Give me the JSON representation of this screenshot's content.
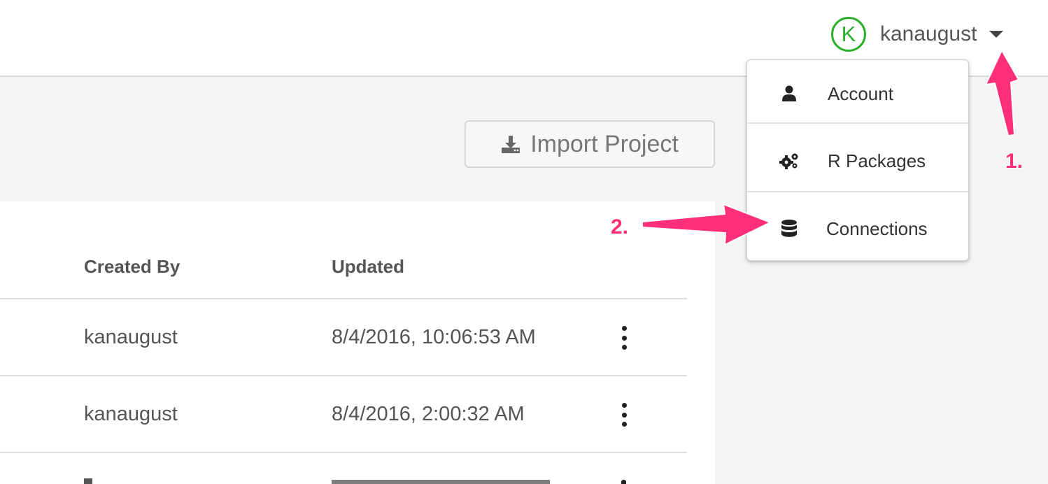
{
  "header": {
    "avatar_letter": "K",
    "username": "kanaugust",
    "accent_color": "#2bb02b"
  },
  "toolbar": {
    "import_label": "Import Project",
    "import_icon": "download-tray-icon"
  },
  "table": {
    "columns": [
      "Created By",
      "Updated"
    ],
    "rows": [
      {
        "created_by": "kanaugust",
        "updated": "8/4/2016, 10:06:53 AM"
      },
      {
        "created_by": "kanaugust",
        "updated": "8/4/2016, 2:00:32 AM"
      }
    ]
  },
  "menu": {
    "items": [
      {
        "label": "Account",
        "icon": "user-icon"
      },
      {
        "label": "R Packages",
        "icon": "gears-icon"
      },
      {
        "label": "Connections",
        "icon": "database-icon"
      }
    ]
  },
  "annotations": {
    "step1": "1.",
    "step2": "2.",
    "color": "#ff2f7a"
  }
}
